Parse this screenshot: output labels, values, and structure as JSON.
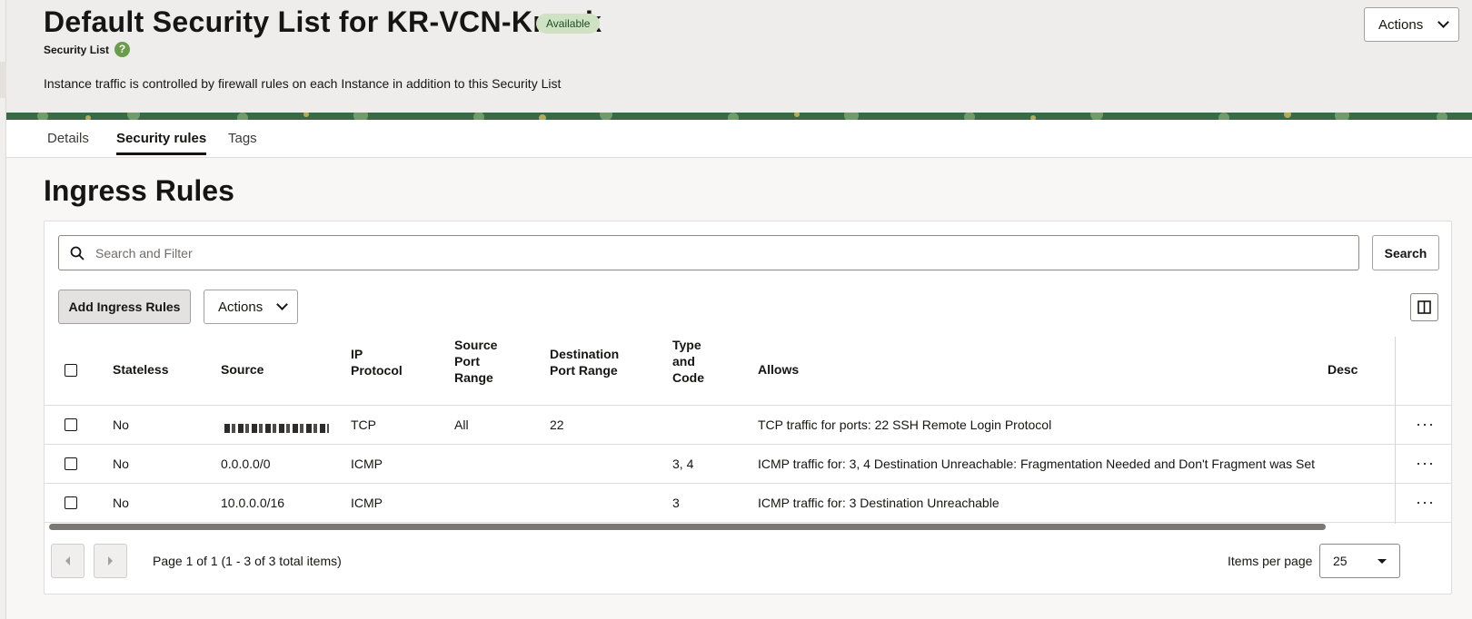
{
  "header": {
    "title": "Default Security List for KR-VCN-Knock",
    "status": "Available",
    "resource_type": "Security List",
    "help_icon": "?",
    "info": "Instance traffic is controlled by firewall rules on each Instance in addition to this Security List",
    "actions_label": "Actions"
  },
  "tabs": [
    {
      "label": "Details",
      "active": false
    },
    {
      "label": "Security rules",
      "active": true
    },
    {
      "label": "Tags",
      "active": false
    }
  ],
  "section": {
    "title": "Ingress Rules"
  },
  "toolbar": {
    "search_placeholder": "Search and Filter",
    "search_value": "",
    "search_label": "Search",
    "add_label": "Add Ingress Rules",
    "actions_label": "Actions"
  },
  "table": {
    "columns": {
      "stateless": "Stateless",
      "source": "Source",
      "ip_protocol_1": "IP",
      "ip_protocol_2": "Protocol",
      "src_port_1": "Source",
      "src_port_2": "Port",
      "src_port_3": "Range",
      "dst_port_1": "Destination",
      "dst_port_2": "Port Range",
      "type_1": "Type",
      "type_2": "and",
      "type_3": "Code",
      "allows": "Allows",
      "description": "Desc"
    },
    "rows": [
      {
        "stateless": "No",
        "source": "",
        "source_masked": true,
        "protocol": "TCP",
        "src_port": "All",
        "dst_port": "22",
        "type_code": "",
        "allows": "TCP traffic for ports: 22 SSH Remote Login Protocol",
        "kebab": "···"
      },
      {
        "stateless": "No",
        "source": "0.0.0.0/0",
        "source_masked": false,
        "protocol": "ICMP",
        "src_port": "",
        "dst_port": "",
        "type_code": "3, 4",
        "allows": "ICMP traffic for: 3, 4 Destination Unreachable: Fragmentation Needed and Don't Fragment was Set",
        "kebab": "···"
      },
      {
        "stateless": "No",
        "source": "10.0.0.0/16",
        "source_masked": false,
        "protocol": "ICMP",
        "src_port": "",
        "dst_port": "",
        "type_code": "3",
        "allows": "ICMP traffic for: 3 Destination Unreachable",
        "kebab": "···"
      }
    ]
  },
  "pagination": {
    "info": "Page 1 of 1 (1 - 3 of 3 total items)",
    "items_per_page_label": "Items per page",
    "items_per_page_value": "25"
  },
  "colors": {
    "badge_bg": "#cfe3c4",
    "header_bg": "#efedeb",
    "text": "#161513",
    "banner": "#3a6a45"
  }
}
